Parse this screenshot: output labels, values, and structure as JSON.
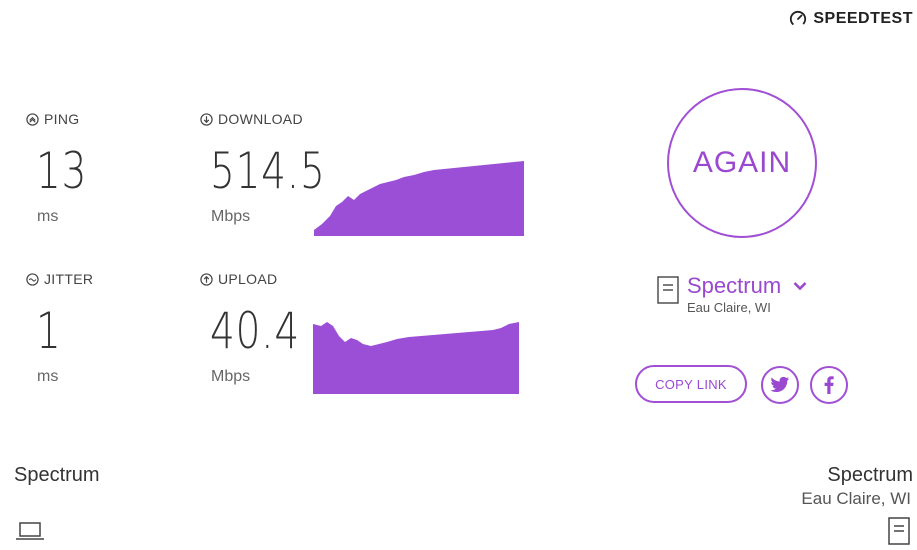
{
  "brand": {
    "name": "SPEEDTEST",
    "icon": "gauge-icon"
  },
  "ping": {
    "label": "PING",
    "value": "13",
    "unit": "ms",
    "icon": "ping-icon"
  },
  "download": {
    "label": "DOWNLOAD",
    "value": "514.5",
    "unit": "Mbps",
    "icon": "download-icon"
  },
  "jitter": {
    "label": "JITTER",
    "value": "1",
    "unit": "ms",
    "icon": "jitter-icon"
  },
  "upload": {
    "label": "UPLOAD",
    "value": "40.4",
    "unit": "Mbps",
    "icon": "upload-icon"
  },
  "again": {
    "label": "AGAIN"
  },
  "isp": {
    "name": "Spectrum",
    "location": "Eau Claire, WI"
  },
  "share": {
    "copy_label": "COPY LINK"
  },
  "bottom": {
    "client_name": "Spectrum",
    "server_name": "Spectrum",
    "server_location": "Eau Claire, WI"
  },
  "colors": {
    "accent": "#9a48cf",
    "graph": "#9b4fd6"
  }
}
